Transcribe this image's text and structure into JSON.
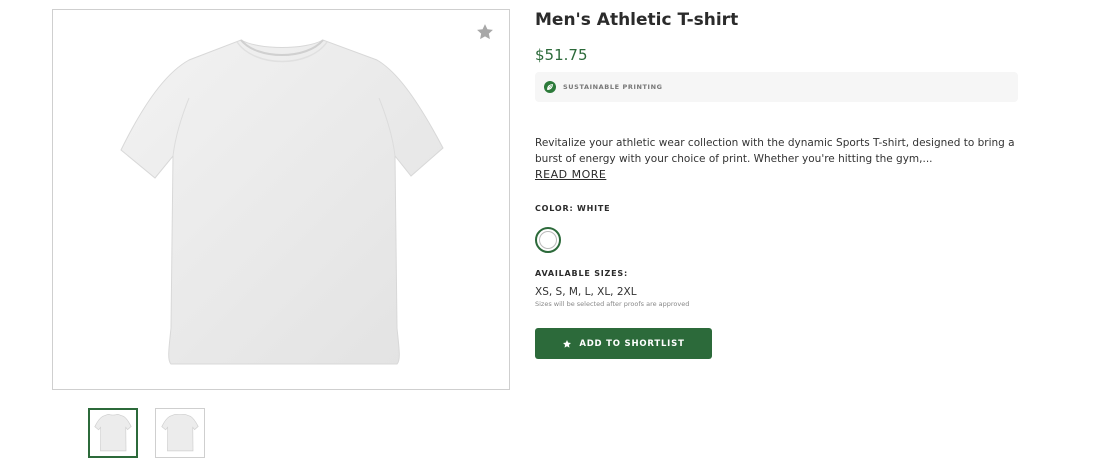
{
  "product": {
    "title": "Men's Athletic T-shirt",
    "price": "$51.75",
    "badge": "SUSTAINABLE PRINTING",
    "description": "Revitalize your athletic wear collection with the dynamic Sports T-shirt, designed to bring a burst of energy with your choice of print. Whether you're hitting the gym,...",
    "read_more": "READ MORE",
    "color_label": "COLOR: WHITE",
    "sizes_label": "AVAILABLE SIZES:",
    "sizes": "XS, S, M, L, XL, 2XL",
    "sizes_note": "Sizes will be selected after proofs are approved",
    "cta": "ADD TO SHORTLIST"
  },
  "icons": {
    "favorite": "star-icon",
    "badge": "leaf-icon",
    "cta": "star-icon"
  },
  "colors": {
    "accent": "#2c6a3a",
    "selected_swatch": "#ffffff"
  }
}
